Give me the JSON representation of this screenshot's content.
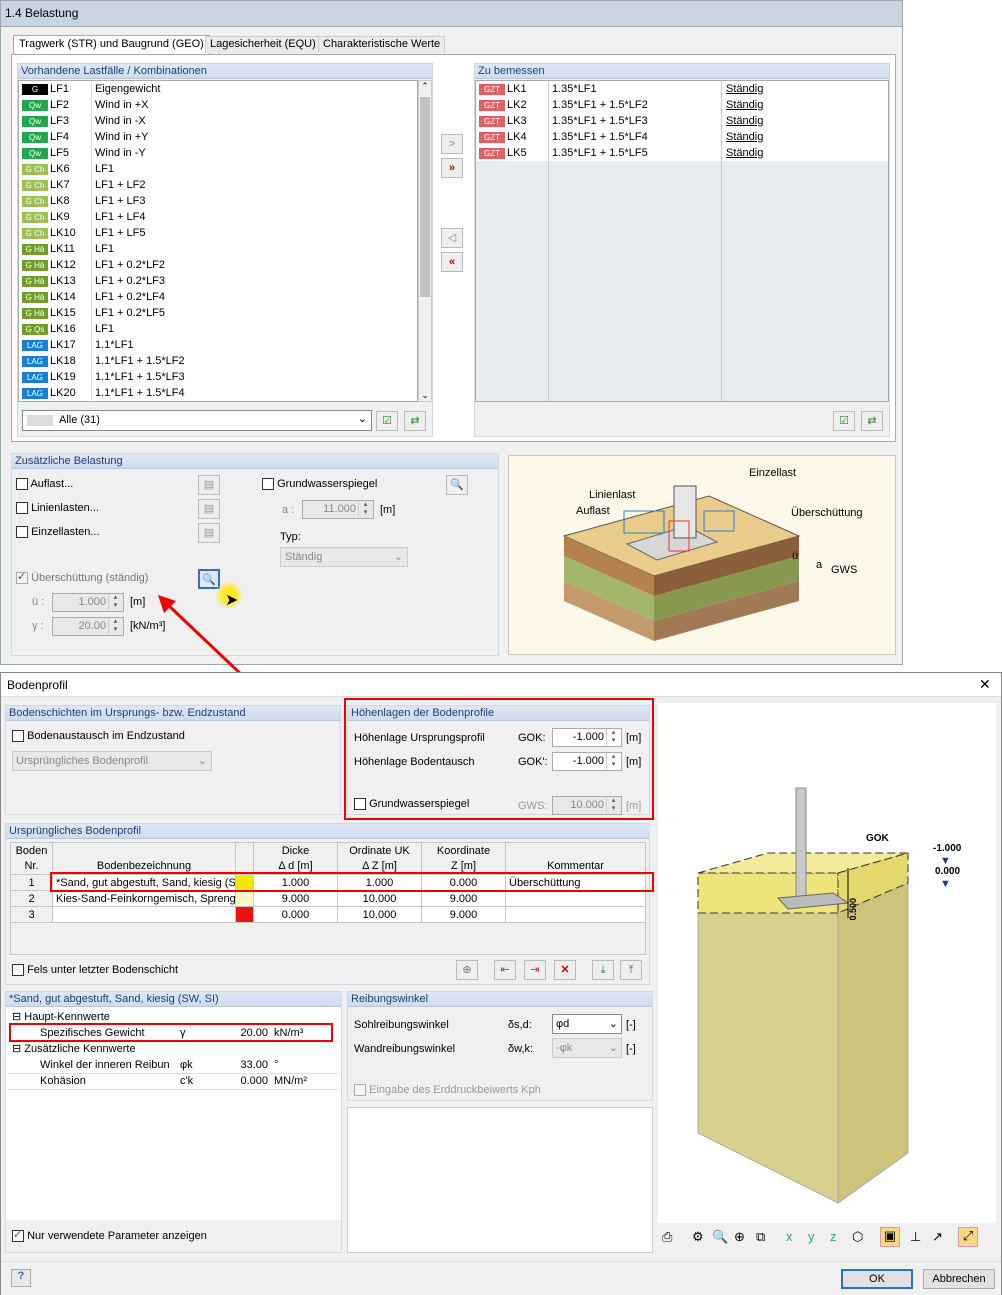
{
  "top": {
    "title": "1.4 Belastung",
    "tabs": [
      "Tragwerk (STR) und Baugrund (GEO)",
      "Lagesicherheit (EQU)",
      "Charakteristische Werte"
    ],
    "left_header": "Vorhandene Lastfälle / Kombinationen",
    "right_header": "Zu bemessen",
    "left_items": [
      {
        "badge": "G",
        "color": "#000000",
        "id": "LF1",
        "desc": "Eigengewicht"
      },
      {
        "badge": "Qw",
        "color": "#22a84a",
        "id": "LF2",
        "desc": "Wind in +X"
      },
      {
        "badge": "Qw",
        "color": "#22a84a",
        "id": "LF3",
        "desc": "Wind in -X"
      },
      {
        "badge": "Qw",
        "color": "#22a84a",
        "id": "LF4",
        "desc": "Wind in +Y"
      },
      {
        "badge": "Qw",
        "color": "#22a84a",
        "id": "LF5",
        "desc": "Wind in -Y"
      },
      {
        "badge": "G Ch",
        "color": "#9cbf5a",
        "id": "LK6",
        "desc": "LF1"
      },
      {
        "badge": "G Ch",
        "color": "#9cbf5a",
        "id": "LK7",
        "desc": "LF1 + LF2"
      },
      {
        "badge": "G Ch",
        "color": "#9cbf5a",
        "id": "LK8",
        "desc": "LF1 + LF3"
      },
      {
        "badge": "G Ch",
        "color": "#9cbf5a",
        "id": "LK9",
        "desc": "LF1 + LF4"
      },
      {
        "badge": "G Ch",
        "color": "#9cbf5a",
        "id": "LK10",
        "desc": "LF1 + LF5"
      },
      {
        "badge": "G Hä",
        "color": "#6f9e2f",
        "id": "LK11",
        "desc": "LF1"
      },
      {
        "badge": "G Hä",
        "color": "#6f9e2f",
        "id": "LK12",
        "desc": "LF1 + 0.2*LF2"
      },
      {
        "badge": "G Hä",
        "color": "#6f9e2f",
        "id": "LK13",
        "desc": "LF1 + 0.2*LF3"
      },
      {
        "badge": "G Hä",
        "color": "#6f9e2f",
        "id": "LK14",
        "desc": "LF1 + 0.2*LF4"
      },
      {
        "badge": "G Hä",
        "color": "#6f9e2f",
        "id": "LK15",
        "desc": "LF1 + 0.2*LF5"
      },
      {
        "badge": "G Qs",
        "color": "#6f9e2f",
        "id": "LK16",
        "desc": "LF1"
      },
      {
        "badge": "LAG",
        "color": "#1a7fd4",
        "id": "LK17",
        "desc": "1.1*LF1"
      },
      {
        "badge": "LAG",
        "color": "#1a7fd4",
        "id": "LK18",
        "desc": "1.1*LF1 + 1.5*LF2"
      },
      {
        "badge": "LAG",
        "color": "#1a7fd4",
        "id": "LK19",
        "desc": "1.1*LF1 + 1.5*LF3"
      },
      {
        "badge": "LAG",
        "color": "#1a7fd4",
        "id": "LK20",
        "desc": "1.1*LF1 + 1.5*LF4"
      }
    ],
    "right_items": [
      {
        "badge": "GZT",
        "id": "LK1",
        "desc": "1.35*LF1",
        "type": "Ständig"
      },
      {
        "badge": "GZT",
        "id": "LK2",
        "desc": "1.35*LF1 + 1.5*LF2",
        "type": "Ständig"
      },
      {
        "badge": "GZT",
        "id": "LK3",
        "desc": "1.35*LF1 + 1.5*LF3",
        "type": "Ständig"
      },
      {
        "badge": "GZT",
        "id": "LK4",
        "desc": "1.35*LF1 + 1.5*LF4",
        "type": "Ständig"
      },
      {
        "badge": "GZT",
        "id": "LK5",
        "desc": "1.35*LF1 + 1.5*LF5",
        "type": "Ständig"
      }
    ],
    "filter": "Alle (31)",
    "zus_header": "Zusätzliche Belastung",
    "auflast": "Auflast...",
    "linienlasten": "Linienlasten...",
    "einzellasten": "Einzellasten...",
    "ueberschuettung": "Überschüttung (ständig)",
    "u_label": "ü :",
    "u_value": "1.000",
    "u_unit": "[m]",
    "g_label": "γ :",
    "g_value": "20.00",
    "g_unit": "[kN/m³]",
    "gws_label": "Grundwasserspiegel",
    "a_label": "a :",
    "a_value": "11.000",
    "a_unit": "[m]",
    "typ_label": "Typ:",
    "typ_value": "Ständig",
    "fig_labels": {
      "einzellast": "Einzellast",
      "linienlast": "Linienlast",
      "auflast": "Auflast",
      "ueberschuettung": "Überschüttung",
      "gws": "GWS",
      "u": "ü",
      "a": "a"
    }
  },
  "dlg": {
    "title": "Bodenprofil",
    "close": "✕",
    "boden_header": "Bodenschichten im Ursprungs- bzw. Endzustand",
    "bodenaustausch": "Bodenaustausch im Endzustand",
    "profil_select": "Ursprüngliches Bodenprofil",
    "hoehen_header": "Höhenlagen der Bodenprofile",
    "hu_label": "Höhenlage Ursprungsprofil",
    "hu_sym": "GOK:",
    "hu_value": "-1.000",
    "hu_unit": "[m]",
    "hb_label": "Höhenlage Bodentausch",
    "hb_sym": "GOK':",
    "hb_value": "-1.000",
    "hb_unit": "[m]",
    "gws_label": "Grundwasserspiegel",
    "gws_sym": "GWS:",
    "gws_value": "10.000",
    "gws_unit": "[m]",
    "orig_header": "Ursprüngliches Bodenprofil",
    "cols": {
      "boden": "Boden",
      "nr": "Nr.",
      "bez": "Bodenbezeichnung",
      "dicke": "Dicke",
      "dicke2": "Δ d [m]",
      "ord": "Ordinate UK",
      "ord2": "Δ Z [m]",
      "koord": "Koordinate",
      "koord2": "Z [m]",
      "komm": "Kommentar"
    },
    "rows": [
      {
        "nr": "1",
        "bez": "*Sand, gut abgestuft, Sand, kiesig (S",
        "color": "#f5e800",
        "dicke": "1.000",
        "ord": "1.000",
        "koord": "0.000",
        "komm": "Überschüttung"
      },
      {
        "nr": "2",
        "bez": "Kies-Sand-Feinkorngemisch, Sprengu",
        "color": "#fff8c8",
        "dicke": "9.000",
        "ord": "10.000",
        "koord": "9.000",
        "komm": ""
      },
      {
        "nr": "3",
        "bez": "",
        "color": "#ee1111",
        "dicke": "0.000",
        "ord": "10.000",
        "koord": "9.000",
        "komm": ""
      }
    ],
    "fels": "Fels unter letzter Bodenschicht",
    "prop_header": "*Sand, gut abgestuft, Sand, kiesig (SW, SI)",
    "haupt": "Haupt-Kennwerte",
    "spez": "Spezifisches Gewicht",
    "spez_sym": "γ",
    "spez_val": "20.00",
    "spez_unit": "kN/m³",
    "zus": "Zusätzliche Kennwerte",
    "winkel": "Winkel der inneren Reibun",
    "winkel_sym": "φk",
    "winkel_val": "33.00",
    "winkel_unit": "°",
    "koh": "Kohäsion",
    "koh_sym": "c'k",
    "koh_val": "0.000",
    "koh_unit": "MN/m²",
    "nur": "Nur verwendete Parameter anzeigen",
    "reib_header": "Reibungswinkel",
    "sohl": "Sohlreibungswinkel",
    "sohl_sym": "δs,d:",
    "sohl_val": "φd",
    "sohl_unit": "[-]",
    "wand": "Wandreibungswinkel",
    "wand_sym": "δw,k:",
    "wand_val": "-φk",
    "wand_unit": "[-]",
    "kph": "Eingabe des Erddruckbeiwerts Kph",
    "view": {
      "gok": "GOK",
      "v1": "-1.000",
      "v2": "0.000",
      "dim": "0.500"
    },
    "ok": "OK",
    "cancel": "Abbrechen"
  }
}
